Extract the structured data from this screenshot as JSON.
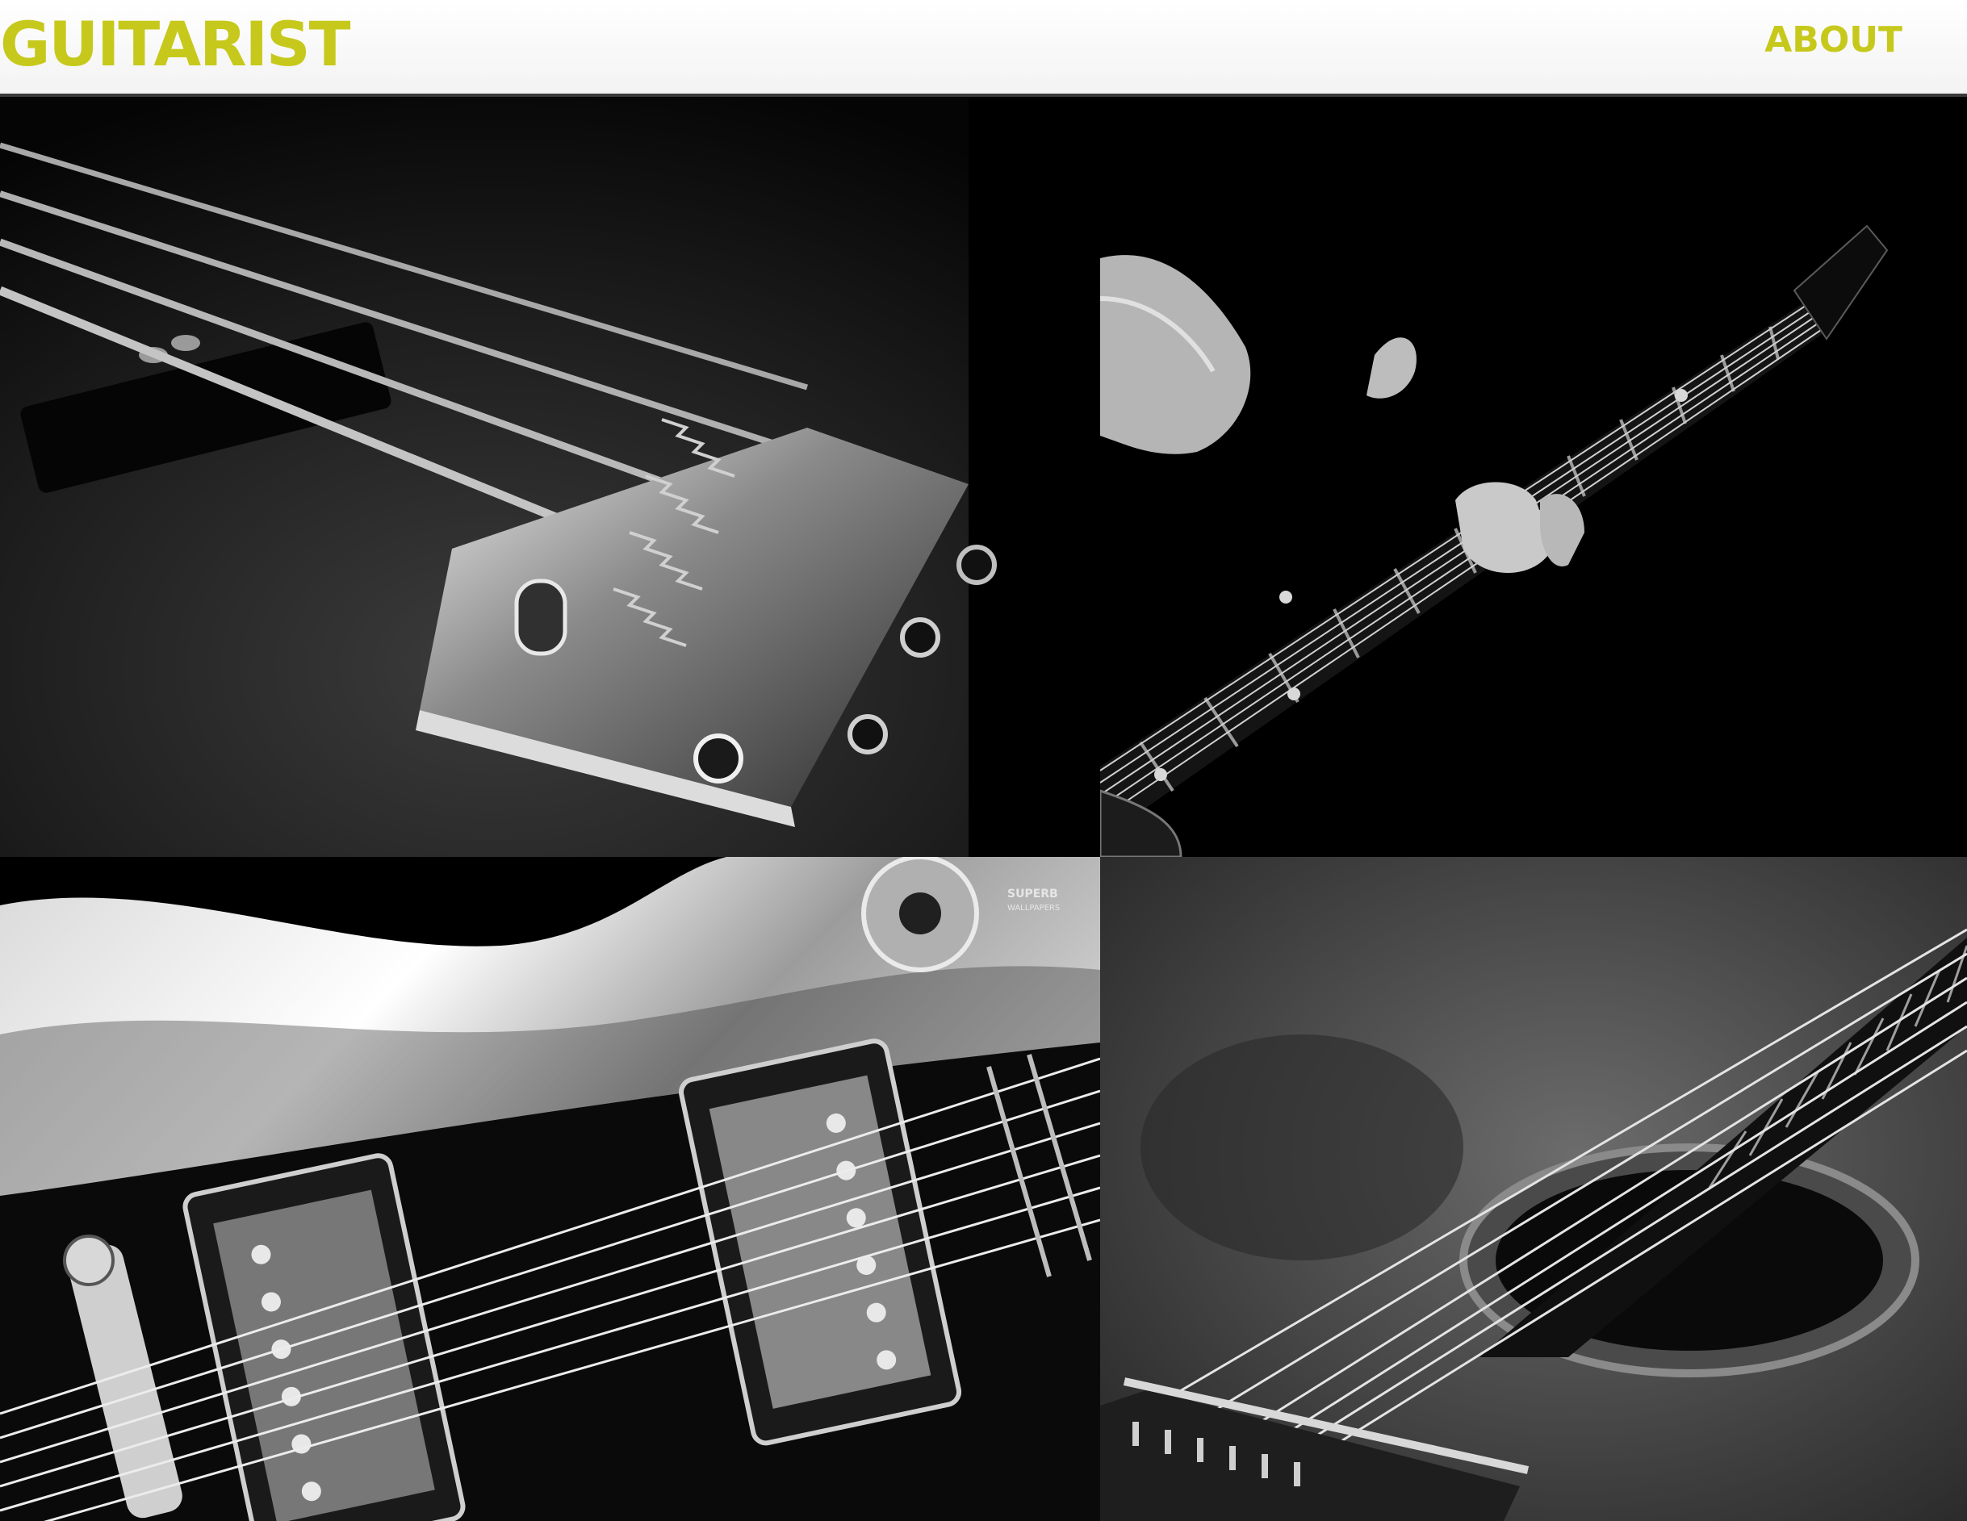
{
  "header": {
    "logo_text": "GUITARIST",
    "nav": {
      "about_label": "ABOUT"
    }
  },
  "theme": {
    "accent": "#c6c91b",
    "header_bg": "#f7f7f7",
    "page_bg": "#000000"
  },
  "gallery": {
    "tiles": [
      {
        "subject": "bass-bridge-photo"
      },
      {
        "subject": "guitarist-fretting-hand-photo"
      },
      {
        "subject": "electric-guitar-pickups-photo"
      },
      {
        "subject": "acoustic-guitar-soundhole-photo"
      }
    ],
    "watermark": {
      "line1": "SUPERB",
      "line2": "WALLPAPERS"
    }
  }
}
